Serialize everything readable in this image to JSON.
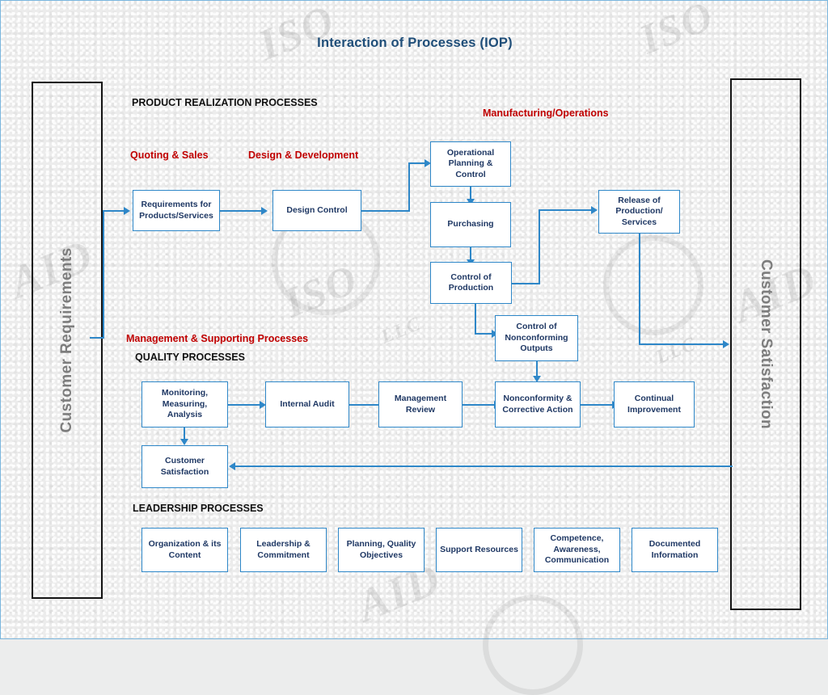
{
  "title": "Interaction of Processes (IOP)",
  "colors": {
    "title": "#1f4e79",
    "box_border": "#2e87c8",
    "box_text": "#1f3864",
    "connector": "#2e87c8",
    "red_label": "#c00000",
    "black_label": "#111111",
    "panel_border": "#141414",
    "panel_text": "#7d7d7d",
    "page_border": "#7ab6de",
    "background": "#ececec"
  },
  "panels": {
    "left": "Customer Requirements",
    "right": "Customer Satisfaction"
  },
  "headings": {
    "product_realization": "PRODUCT REALIZATION PROCESSES",
    "manufacturing_operations": "Manufacturing/Operations",
    "quoting_sales": "Quoting & Sales",
    "design_development": "Design & Development",
    "management_supporting": "Management & Supporting Processes",
    "quality_processes": "QUALITY PROCESSES",
    "leadership_processes": "LEADERSHIP PROCESSES"
  },
  "boxes": {
    "requirements": "Requirements for Products/Services",
    "design_control": "Design Control",
    "operational_planning": "Operational Planning & Control",
    "purchasing": "Purchasing",
    "control_production": "Control of Production",
    "release_production": "Release of Production/ Services",
    "control_nonconforming": "Control of Nonconforming Outputs",
    "monitoring": "Monitoring, Measuring, Analysis",
    "internal_audit": "Internal Audit",
    "management_review": "Management Review",
    "nonconformity": "Nonconformity & Corrective Action",
    "continual_improvement": "Continual Improvement",
    "customer_satisfaction": "Customer Satisfaction",
    "organization": "Organization & its Content",
    "leadership_commitment": "Leadership & Commitment",
    "planning_quality": "Planning, Quality Objectives",
    "support_resources": "Support Resources",
    "competence": "Competence, Awareness, Communication",
    "documented_information": "Documented Information"
  },
  "watermarks": [
    "ISO",
    "ISO",
    "ISO",
    "AID",
    "AID",
    "AID",
    "LLC",
    "LLC"
  ]
}
